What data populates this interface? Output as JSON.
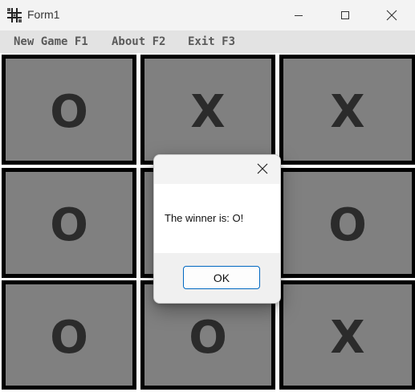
{
  "window": {
    "title": "Form1",
    "icon": "tic-tac-toe-grid-icon",
    "controls": [
      "minimize-icon",
      "maximize-icon",
      "close-icon"
    ]
  },
  "menu": {
    "items": [
      {
        "label": "New Game F1"
      },
      {
        "label": "About F2"
      },
      {
        "label": "Exit F3"
      }
    ]
  },
  "board": {
    "cells": [
      "O",
      "X",
      "X",
      "O",
      "",
      "O",
      "O",
      "O",
      "X"
    ]
  },
  "dialog": {
    "message": "The winner is: O!",
    "ok_label": "OK",
    "close_icon": "close-icon"
  },
  "colors": {
    "cell_bg": "#808080",
    "cell_border": "#000000",
    "mark": "#2b2b2b",
    "accent": "#0067c0"
  }
}
